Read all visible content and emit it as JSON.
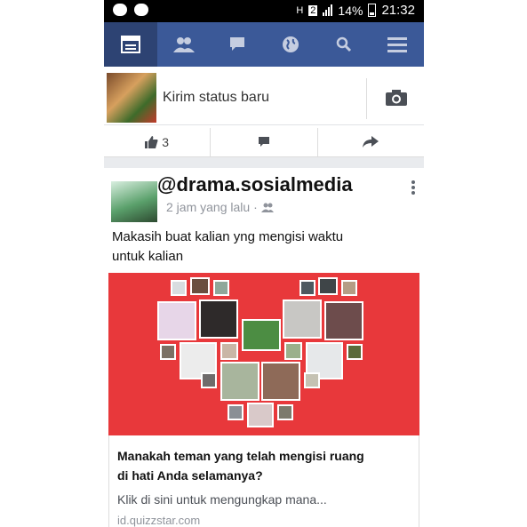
{
  "status_bar": {
    "icons_left": [
      "messenger-icon",
      "chat-icon"
    ],
    "network": "2",
    "battery": "14%",
    "time": "21:32"
  },
  "nav": {
    "items": [
      {
        "name": "news-feed-icon",
        "active": true
      },
      {
        "name": "friend-requests-icon",
        "active": false
      },
      {
        "name": "messages-icon",
        "active": false
      },
      {
        "name": "notifications-globe-icon",
        "active": false
      },
      {
        "name": "search-icon",
        "active": false
      },
      {
        "name": "menu-icon",
        "active": false
      }
    ]
  },
  "composer": {
    "placeholder": "Kirim status baru"
  },
  "actions": {
    "like_count": "3"
  },
  "post": {
    "author": "@drama.sosialmedia",
    "time": "2 jam yang lalu",
    "text_line1": "Makasih buat kalian yng mengisi waktu",
    "text_line2": "untuk kalian",
    "link": {
      "title_line1": "Manakah teman yang telah mengisi ruang",
      "title_line2": "di hati Anda selamanya?",
      "description": "Klik di sini untuk mengungkap mana...",
      "domain": "id.quizzstar.com"
    },
    "image_colors": {
      "background": "#e8383b"
    }
  },
  "colors": {
    "nav_bg": "#3b5998",
    "nav_active": "#2d4373"
  }
}
